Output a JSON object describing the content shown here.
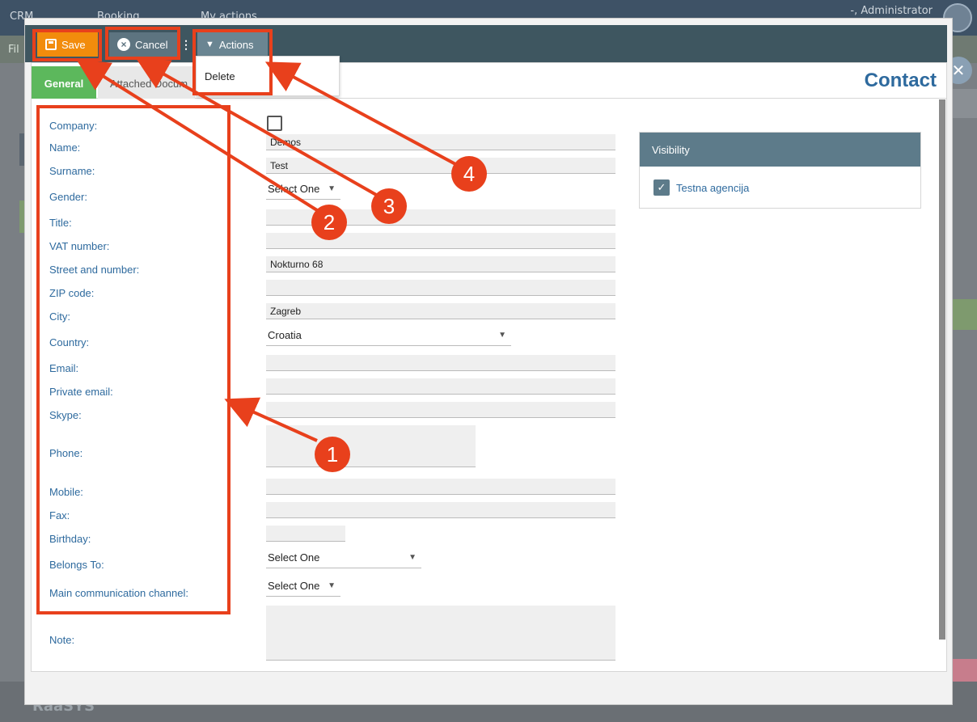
{
  "background": {
    "nav_items": [
      "CRM",
      "Booking",
      "My actions"
    ],
    "user": "-, Administrator",
    "filter_label": "Fil",
    "footer_brand": "RaaSYS"
  },
  "toolbar": {
    "save_label": "Save",
    "cancel_label": "Cancel",
    "more_label": "⋮",
    "actions_label": "Actions",
    "actions_menu": [
      "Delete"
    ]
  },
  "tabs": [
    {
      "label": "General",
      "active": true
    },
    {
      "label": "Attached Docum",
      "active": false
    }
  ],
  "page_title": "Contact",
  "form": {
    "labels": {
      "company": "Company:",
      "name": "Name:",
      "surname": "Surname:",
      "gender": "Gender:",
      "title": "Title:",
      "vat": "VAT number:",
      "street": "Street and number:",
      "zip": "ZIP code:",
      "city": "City:",
      "country": "Country:",
      "email": "Email:",
      "private_email": "Private email:",
      "skype": "Skype:",
      "phone": "Phone:",
      "mobile": "Mobile:",
      "fax": "Fax:",
      "birthday": "Birthday:",
      "belongs_to": "Belongs To:",
      "main_channel": "Main communication channel:",
      "note": "Note:"
    },
    "values": {
      "company_checked": false,
      "name": "Demos",
      "surname": "Test",
      "gender": "Select One",
      "title": "",
      "vat": "",
      "street": "Nokturno 68",
      "zip": "",
      "city": "Zagreb",
      "country": "Croatia",
      "email": "",
      "private_email": "",
      "skype": "",
      "phone": "",
      "mobile": "",
      "fax": "",
      "birthday": "",
      "belongs_to": "Select One",
      "main_channel": "Select One",
      "note": ""
    }
  },
  "visibility": {
    "heading": "Visibility",
    "items": [
      {
        "label": "Testna agencija",
        "checked": true
      }
    ]
  },
  "annotations": [
    "1",
    "2",
    "3",
    "4"
  ],
  "colors": {
    "annotation": "#e8401c",
    "save": "#f28c0c",
    "active_tab": "#5cb85c",
    "title": "#2e6a9e"
  }
}
